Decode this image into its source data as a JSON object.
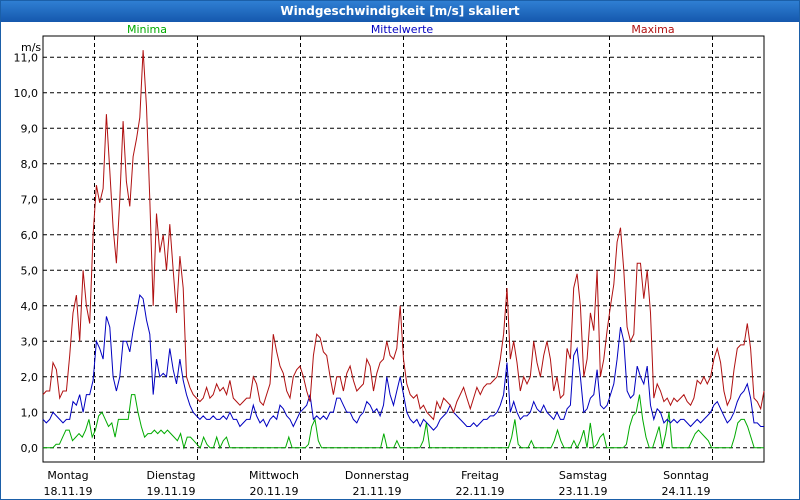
{
  "window": {
    "title": "Windgeschwindigkeit [m/s] skaliert"
  },
  "chart_data": {
    "type": "line",
    "title": "Windgeschwindigkeit [m/s] skaliert",
    "ylabel": "m/s",
    "ylim": [
      -0.4,
      11.6
    ],
    "yticks": [
      "0,0",
      "1,0",
      "2,0",
      "3,0",
      "4,0",
      "5,0",
      "6,0",
      "7,0",
      "8,0",
      "9,0",
      "10,0",
      "11,0"
    ],
    "xlim": [
      0,
      7
    ],
    "grid": true,
    "days": [
      {
        "weekday": "Montag",
        "date": "18.11.19"
      },
      {
        "weekday": "Dienstag",
        "date": "19.11.19"
      },
      {
        "weekday": "Mittwoch",
        "date": "20.11.19"
      },
      {
        "weekday": "Donnerstag",
        "date": "21.11.19"
      },
      {
        "weekday": "Freitag",
        "date": "22.11.19"
      },
      {
        "weekday": "Samstag",
        "date": "23.11.19"
      },
      {
        "weekday": "Sonntag",
        "date": "24.11.19"
      }
    ],
    "series": [
      {
        "name": "Minima",
        "color": "#00aa00",
        "values": [
          0,
          0,
          0,
          0,
          0.1,
          0.1,
          0.3,
          0.5,
          0.5,
          0.2,
          0.3,
          0.4,
          0.3,
          0.5,
          0.8,
          0.3,
          0.5,
          0.9,
          1.0,
          0.8,
          0.6,
          0.7,
          0.3,
          0.8,
          0.8,
          0.8,
          0.8,
          1.5,
          1.5,
          1.0,
          0.6,
          0.3,
          0.4,
          0.4,
          0.5,
          0.4,
          0.5,
          0.4,
          0.5,
          0.4,
          0.3,
          0.2,
          0.4,
          0,
          0.3,
          0.3,
          0.2,
          0.1,
          0,
          0.3,
          0.1,
          0,
          0,
          0.3,
          0,
          0.2,
          0.3,
          0,
          0,
          0,
          0,
          0,
          0,
          0,
          0,
          0,
          0,
          0,
          0,
          0,
          0,
          0,
          0,
          0,
          0,
          0.3,
          0,
          0,
          0,
          0,
          0,
          0.1,
          0.6,
          0.8,
          0.2,
          0,
          0,
          0,
          0,
          0,
          0,
          0,
          0,
          0,
          0,
          0,
          0,
          0,
          0,
          0,
          0,
          0,
          0,
          0,
          0.4,
          0,
          0,
          0,
          0.2,
          0,
          0,
          0,
          0,
          0,
          0,
          0,
          0.2,
          0.7,
          0,
          0,
          0,
          0,
          0,
          0,
          0,
          0,
          0,
          0,
          0,
          0,
          0,
          0,
          0,
          0,
          0,
          0,
          0,
          0,
          0,
          0,
          0,
          0,
          0,
          0.3,
          0.8,
          0.1,
          0,
          0,
          0,
          0.2,
          0,
          0,
          0,
          0,
          0,
          0,
          0.2,
          0.5,
          0.2,
          0,
          0,
          0,
          0.2,
          0,
          0.2,
          0.5,
          0,
          0.7,
          0,
          0.1,
          0.3,
          0.4,
          0,
          0,
          0,
          0,
          0,
          0,
          0.1,
          0.6,
          0.9,
          1.0,
          1.5,
          0.8,
          0.3,
          0,
          0,
          0.3,
          0.6,
          0,
          0.4,
          1.0,
          0,
          0,
          0,
          0,
          0,
          0,
          0.2,
          0.4,
          0.5,
          0.4,
          0.3,
          0.2,
          0,
          0,
          0,
          0,
          0,
          0,
          0,
          0.3,
          0.7,
          0.8,
          0.8,
          0.6,
          0.3,
          0,
          0,
          0,
          0
        ]
      },
      {
        "name": "Mittelwerte",
        "color": "#0000c0",
        "values": [
          0.8,
          0.7,
          0.8,
          1.0,
          0.9,
          0.8,
          0.7,
          0.8,
          0.8,
          1.3,
          1.2,
          1.5,
          1.0,
          1.5,
          1.5,
          1.9,
          3.0,
          2.8,
          2.5,
          3.7,
          3.4,
          2.0,
          1.6,
          2.0,
          3.0,
          3.0,
          2.7,
          3.3,
          3.8,
          4.3,
          4.2,
          3.6,
          3.2,
          1.5,
          2.5,
          2.0,
          2.1,
          2.0,
          2.8,
          2.2,
          1.8,
          2.5,
          1.9,
          1.5,
          1.2,
          1.0,
          0.9,
          0.8,
          0.9,
          0.8,
          0.8,
          0.9,
          0.8,
          0.8,
          0.9,
          0.8,
          1.0,
          0.8,
          0.8,
          0.6,
          0.7,
          0.8,
          0.8,
          1.2,
          0.9,
          0.7,
          0.8,
          0.6,
          0.8,
          0.9,
          0.8,
          1.2,
          1.1,
          0.9,
          0.8,
          0.6,
          0.8,
          1.0,
          1.1,
          1.2,
          1.5,
          0.8,
          0.9,
          0.8,
          0.9,
          0.8,
          1.0,
          1.0,
          1.4,
          1.4,
          1.2,
          1.0,
          1.0,
          0.8,
          0.7,
          0.9,
          1.0,
          1.3,
          1.2,
          1.0,
          1.1,
          0.9,
          1.2,
          2.0,
          1.5,
          1.2,
          1.6,
          2.0,
          1.5,
          1.0,
          0.8,
          0.7,
          0.8,
          0.6,
          0.8,
          0.7,
          0.6,
          0.5,
          0.6,
          0.8,
          0.9,
          1.0,
          1.2,
          1.0,
          0.9,
          0.8,
          0.7,
          0.6,
          0.6,
          0.7,
          0.6,
          0.7,
          0.8,
          0.8,
          0.9,
          0.9,
          1.0,
          1.2,
          1.5,
          2.4,
          1.0,
          1.3,
          1.0,
          0.8,
          0.9,
          0.9,
          1.0,
          1.3,
          1.1,
          1.0,
          1.2,
          1.0,
          0.9,
          0.8,
          1.0,
          0.8,
          0.8,
          1.1,
          1.2,
          2.6,
          2.8,
          2.0,
          1.0,
          1.1,
          1.4,
          1.5,
          2.2,
          1.2,
          1.1,
          1.2,
          1.5,
          1.8,
          2.5,
          3.4,
          3.0,
          1.6,
          1.4,
          1.5,
          2.3,
          2.0,
          1.8,
          2.3,
          1.2,
          0.8,
          1.1,
          1.0,
          0.7,
          0.8,
          0.7,
          0.8,
          0.7,
          0.8,
          0.8,
          0.7,
          0.6,
          0.7,
          0.8,
          0.7,
          0.8,
          0.9,
          1.0,
          1.2,
          1.3,
          1.1,
          0.9,
          0.7,
          0.8,
          1.0,
          1.3,
          1.5,
          1.6,
          1.8,
          1.4,
          0.7,
          0.7,
          0.6,
          0.6
        ]
      },
      {
        "name": "Maxima",
        "color": "#b01010",
        "values": [
          1.5,
          1.6,
          1.6,
          2.4,
          2.2,
          1.4,
          1.6,
          1.6,
          2.6,
          3.8,
          4.3,
          3.0,
          5.0,
          4.0,
          3.5,
          6.0,
          7.4,
          6.9,
          7.3,
          9.4,
          7.8,
          6.2,
          5.2,
          7.0,
          9.2,
          7.5,
          6.8,
          8.2,
          8.7,
          9.3,
          11.2,
          9.6,
          7.0,
          4.0,
          6.6,
          5.5,
          6.0,
          5.0,
          6.3,
          5.0,
          3.8,
          5.4,
          4.5,
          2.0,
          1.7,
          1.5,
          1.4,
          1.3,
          1.4,
          1.7,
          1.4,
          1.5,
          1.8,
          1.6,
          1.7,
          1.5,
          1.9,
          1.4,
          1.3,
          1.2,
          1.3,
          1.4,
          1.4,
          2.0,
          1.8,
          1.3,
          1.2,
          1.5,
          1.8,
          3.2,
          2.7,
          2.3,
          2.1,
          1.6,
          1.4,
          2.0,
          2.2,
          2.3,
          2.0,
          1.6,
          1.3,
          2.6,
          3.2,
          3.1,
          2.7,
          2.6,
          2.0,
          1.5,
          2.0,
          2.0,
          1.6,
          2.1,
          2.3,
          1.9,
          1.6,
          1.7,
          1.8,
          2.5,
          2.3,
          1.6,
          2.1,
          2.4,
          2.5,
          3.0,
          2.6,
          2.5,
          2.8,
          4.0,
          2.5,
          1.8,
          1.5,
          1.4,
          1.5,
          1.1,
          1.2,
          1.0,
          0.9,
          0.8,
          1.3,
          1.1,
          1.4,
          1.3,
          1.2,
          1.0,
          1.3,
          1.5,
          1.7,
          1.4,
          1.1,
          1.4,
          1.7,
          1.5,
          1.7,
          1.8,
          1.8,
          1.9,
          2.0,
          2.5,
          3.2,
          4.5,
          2.5,
          3.0,
          2.4,
          1.6,
          2.0,
          1.8,
          2.0,
          3.0,
          2.4,
          2.0,
          2.6,
          3.0,
          2.5,
          1.6,
          2.0,
          1.4,
          1.5,
          2.8,
          2.5,
          4.5,
          4.9,
          4.0,
          2.0,
          2.5,
          3.8,
          3.3,
          5.0,
          2.0,
          2.5,
          3.3,
          4.0,
          4.6,
          5.8,
          6.2,
          5.0,
          3.4,
          3.0,
          3.2,
          5.2,
          5.2,
          4.2,
          5.0,
          3.8,
          1.4,
          1.8,
          1.6,
          1.3,
          1.4,
          1.2,
          1.4,
          1.3,
          1.4,
          1.5,
          1.3,
          1.2,
          1.4,
          1.9,
          1.8,
          2.0,
          1.8,
          2.0,
          2.5,
          2.8,
          2.4,
          1.6,
          1.2,
          1.4,
          2.2,
          2.8,
          2.9,
          2.9,
          3.5,
          2.8,
          1.4,
          1.3,
          1.1,
          1.6
        ]
      }
    ]
  }
}
